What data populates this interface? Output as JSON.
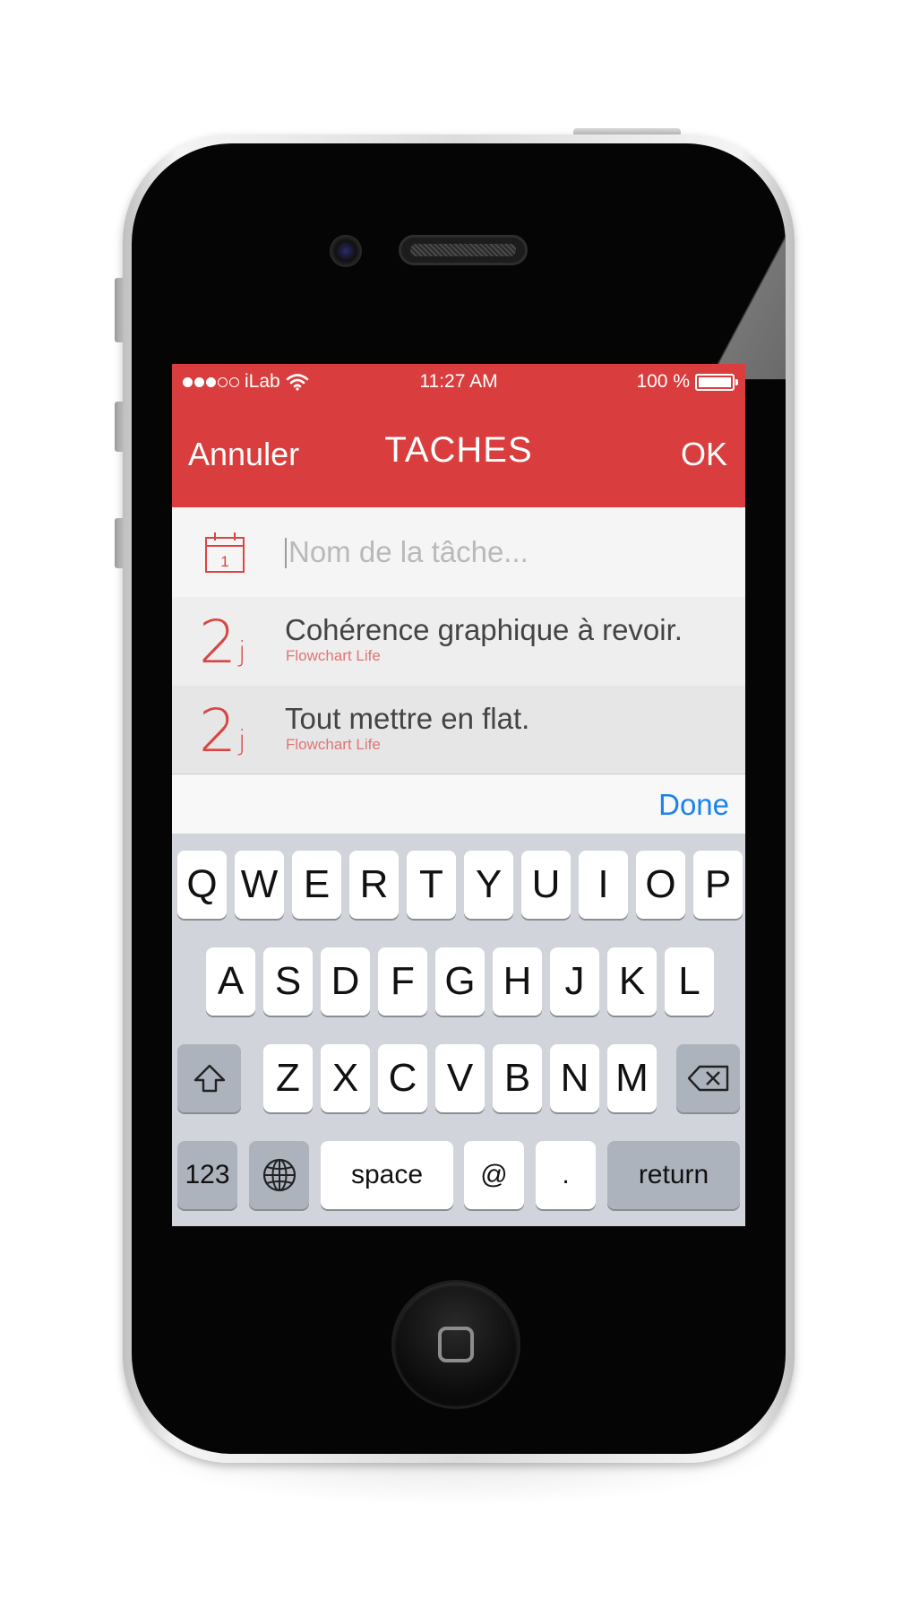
{
  "status_bar": {
    "carrier": "iLab",
    "signal_bars_filled": 3,
    "signal_bars_total": 5,
    "time": "11:27 AM",
    "battery": "100 %",
    "battery_level": 1.0
  },
  "nav": {
    "cancel_label": "Annuler",
    "title": "TACHES",
    "ok_label": "OK"
  },
  "new_task": {
    "calendar_day": "1",
    "placeholder": "Nom de la tâche..."
  },
  "tasks": [
    {
      "days": "2",
      "unit": "j",
      "title": "Cohérence graphique à revoir.",
      "project": "Flowchart Life"
    },
    {
      "days": "2",
      "unit": "j",
      "title": "Tout mettre en flat.",
      "project": "Flowchart Life"
    }
  ],
  "keyboard": {
    "done_label": "Done",
    "row1": [
      "Q",
      "W",
      "E",
      "R",
      "T",
      "Y",
      "U",
      "I",
      "O",
      "P"
    ],
    "row2": [
      "A",
      "S",
      "D",
      "F",
      "G",
      "H",
      "J",
      "K",
      "L"
    ],
    "row3": [
      "Z",
      "X",
      "C",
      "V",
      "B",
      "N",
      "M"
    ],
    "numbers_label": "123",
    "space_label": "space",
    "at_label": "@",
    "dot_label": ".",
    "return_label": "return"
  },
  "colors": {
    "accent_red": "#d93d3d",
    "done_blue": "#1a82f0"
  },
  "icons": [
    "calendar-icon",
    "wifi-icon",
    "battery-icon",
    "shift-icon",
    "delete-icon",
    "globe-icon",
    "home-button-icon"
  ]
}
